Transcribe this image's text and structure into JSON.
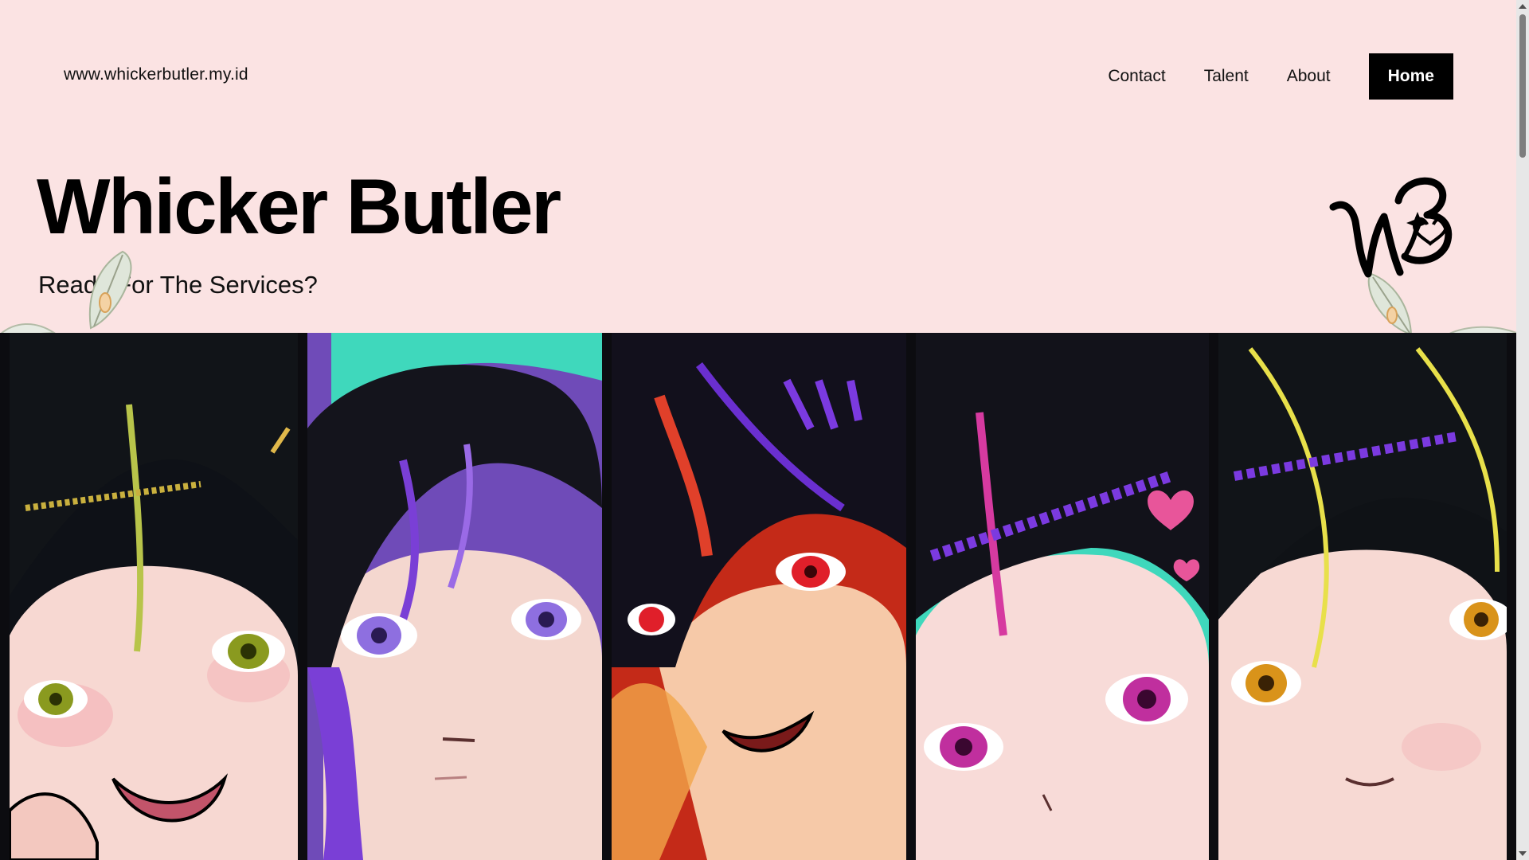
{
  "header": {
    "site_url": "www.whickerbutler.my.id",
    "nav": [
      {
        "label": "Contact"
      },
      {
        "label": "Talent"
      },
      {
        "label": "About"
      }
    ],
    "home_label": "Home"
  },
  "hero": {
    "title": "Whicker Butler",
    "subtitle": "Ready For The Services?"
  },
  "logo": {
    "icon": "wb-monogram-logo-icon"
  },
  "banner": {
    "panels": [
      {
        "icon": "character-portrait-1",
        "hair_highlight": "#b8c44a",
        "eye": "#8a9a1f",
        "bg": "#3fd8bc"
      },
      {
        "icon": "character-portrait-2",
        "hair_highlight": "#7a3fd6",
        "eye": "#8e6fe0",
        "bg": "#6f4bb8"
      },
      {
        "icon": "character-portrait-3",
        "hair_highlight": "#e0402a",
        "eye": "#e01f2a",
        "bg": "#c42a18"
      },
      {
        "icon": "character-portrait-4",
        "hair_highlight": "#d63aa0",
        "eye": "#c02f9e",
        "bg": "#3fd8bc"
      },
      {
        "icon": "character-portrait-5",
        "hair_highlight": "#e8e04a",
        "eye": "#d9931a",
        "bg": "#0f1216"
      }
    ]
  },
  "colors": {
    "background": "#fbe3e3",
    "text": "#000000",
    "home_button_bg": "#000000",
    "home_button_text": "#ffffff"
  }
}
